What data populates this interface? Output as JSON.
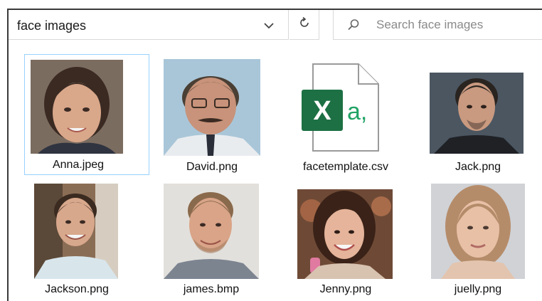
{
  "address_bar": {
    "path": "face images"
  },
  "search": {
    "placeholder": "Search face images"
  },
  "files": [
    {
      "name": "Anna.jpeg",
      "kind": "photo",
      "selected": true
    },
    {
      "name": "David.png",
      "kind": "photo",
      "selected": false
    },
    {
      "name": "facetemplate.csv",
      "kind": "excel-csv",
      "selected": false
    },
    {
      "name": "Jack.png",
      "kind": "photo",
      "selected": false
    },
    {
      "name": "Jackson.png",
      "kind": "photo",
      "selected": false
    },
    {
      "name": "james.bmp",
      "kind": "photo",
      "selected": false
    },
    {
      "name": "Jenny.png",
      "kind": "photo",
      "selected": false
    },
    {
      "name": "juelly.png",
      "kind": "photo",
      "selected": false
    }
  ],
  "csv_icon": {
    "badge_letter": "X",
    "side_text": "a,",
    "badge_color": "#1d7044",
    "text_color": "#21a366"
  },
  "icons": {
    "chevron": "chevron-down-icon",
    "refresh": "refresh-icon",
    "search": "search-icon"
  }
}
